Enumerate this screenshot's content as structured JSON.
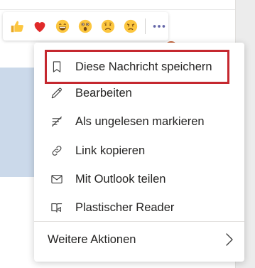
{
  "reactions": [
    {
      "icon": "thumbs-up-icon"
    },
    {
      "icon": "heart-icon"
    },
    {
      "icon": "laughing-face-icon"
    },
    {
      "icon": "surprised-face-icon"
    },
    {
      "icon": "sad-face-icon"
    },
    {
      "icon": "angry-face-icon"
    }
  ],
  "more_options_icon": "more-options-icon",
  "menu": {
    "items": [
      {
        "label": "Diese Nachricht speichern",
        "icon": "bookmark-icon"
      },
      {
        "label": "Bearbeiten",
        "icon": "pencil-icon"
      },
      {
        "label": "Als ungelesen markieren",
        "icon": "mark-unread-icon"
      },
      {
        "label": "Link kopieren",
        "icon": "link-icon"
      },
      {
        "label": "Mit Outlook teilen",
        "icon": "mail-icon"
      },
      {
        "label": "Plastischer Reader",
        "icon": "immersive-reader-icon"
      }
    ],
    "footer": {
      "label": "Weitere Aktionen",
      "icon": "chevron-right-icon"
    }
  },
  "colors": {
    "highlight": "#c5282f",
    "message_bubble": "#cbd9ea",
    "emoji_yellow": "#fcc63f",
    "heart_red": "#e02a2a"
  }
}
